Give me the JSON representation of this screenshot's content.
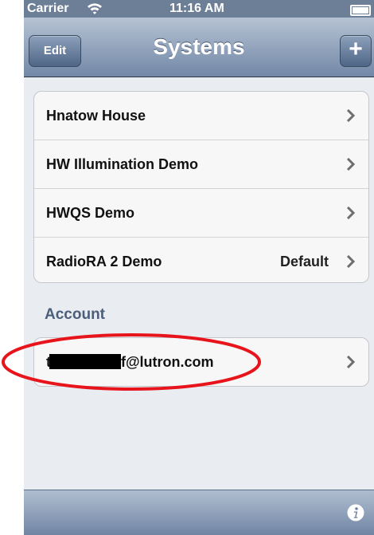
{
  "status_bar": {
    "carrier": "Carrier",
    "time": "11:16 AM"
  },
  "nav": {
    "edit_label": "Edit",
    "title": "Systems",
    "add_label": "+"
  },
  "systems": [
    {
      "name": "Hnatow House",
      "detail": ""
    },
    {
      "name": "HW Illumination Demo",
      "detail": ""
    },
    {
      "name": "HWQS Demo",
      "detail": ""
    },
    {
      "name": "RadioRA 2 Demo",
      "detail": "Default"
    }
  ],
  "account": {
    "header": "Account",
    "email_prefix": "t",
    "email_suffix": "f@lutron.com"
  },
  "icons": {
    "wifi": "wifi-icon",
    "battery": "battery-icon",
    "chevron": "chevron-right-icon",
    "info": "info-icon"
  },
  "colors": {
    "annotation": "#e8141c",
    "nav_gradient_top": "#b5c2d3",
    "nav_gradient_bottom": "#7288a7",
    "section_header": "#4b5e7a"
  }
}
